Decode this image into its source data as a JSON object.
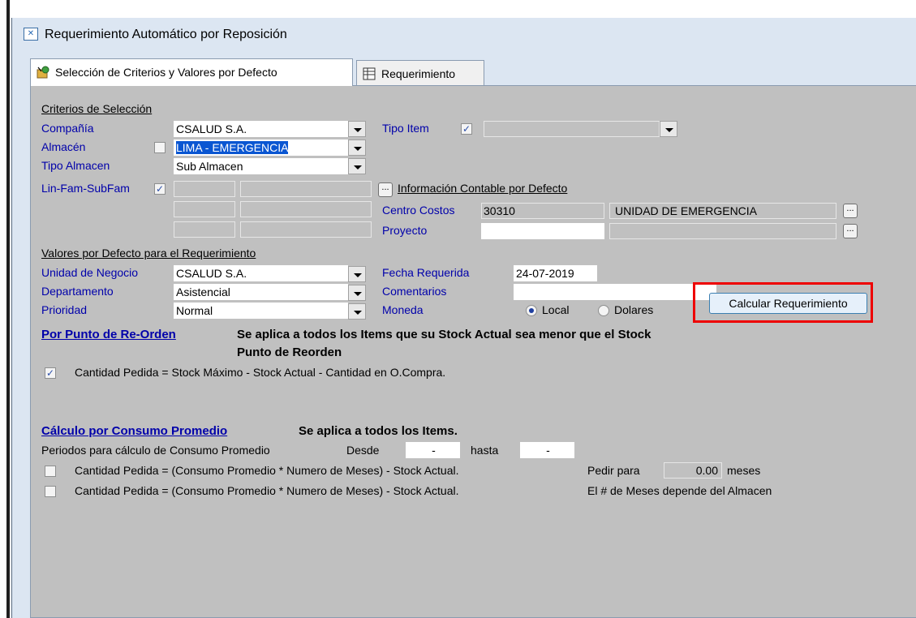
{
  "window": {
    "title": "Requerimiento Automático por Reposición"
  },
  "tabs": [
    {
      "label": "Selección de Criterios y Valores por Defecto",
      "icon": "criteria-icon"
    },
    {
      "label": "Requerimiento",
      "icon": "grid-icon"
    }
  ],
  "criterios": {
    "heading": "Criterios de Selección",
    "compania_label": "Compañía",
    "compania_value": "CSALUD S.A.",
    "tipo_item_label": "Tipo Item",
    "tipo_item_value": "",
    "almacen_label": "Almacén",
    "almacen_value": "LIMA - EMERGENCIA",
    "tipo_almacen_label": "Tipo Almacen",
    "tipo_almacen_value": "Sub Almacen",
    "linfam_label": "Lin-Fam-SubFam"
  },
  "contable": {
    "heading": "Información Contable por Defecto",
    "centro_label": "Centro Costos",
    "centro_code": "30310",
    "centro_name": "UNIDAD DE EMERGENCIA",
    "proyecto_label": "Proyecto",
    "proyecto_code": "",
    "proyecto_name": ""
  },
  "valores": {
    "heading": "Valores por Defecto para el Requerimiento",
    "unidad_label": "Unidad de Negocio",
    "unidad_value": "CSALUD S.A.",
    "fecha_label": "Fecha Requerida",
    "fecha_value": "24-07-2019",
    "depto_label": "Departamento",
    "depto_value": "Asistencial",
    "comentarios_label": "Comentarios",
    "comentarios_value": "",
    "prioridad_label": "Prioridad",
    "prioridad_value": "Normal",
    "moneda_label": "Moneda",
    "moneda_local": "Local",
    "moneda_dolares": "Dolares",
    "calcular_button": "Calcular Requerimiento"
  },
  "reorden": {
    "link": "Por Punto de Re-Orden",
    "desc_line1": "Se aplica a todos los Items que su Stock Actual sea menor que el Stock",
    "desc_line2": "Punto de Reorden",
    "formula": "Cantidad Pedida  =  Stock Máximo - Stock Actual - Cantidad en O.Compra."
  },
  "consumo": {
    "link": "Cálculo por Consumo Promedio",
    "desc": "Se aplica a todos los Items.",
    "periodos_label": "Periodos para cálculo de Consumo Promedio",
    "desde_label": "Desde",
    "desde_value": "-",
    "hasta_label": "hasta",
    "hasta_value": "-",
    "formula1": "Cantidad Pedida  =  (Consumo Promedio * Numero de Meses) - Stock Actual.",
    "pedir_label": "Pedir para",
    "pedir_value": "0.00",
    "meses_label": "meses",
    "formula2": "Cantidad Pedida  =  (Consumo Promedio * Numero de Meses) - Stock Actual.",
    "formula2_note": "El # de Meses depende del Almacen"
  },
  "colors": {
    "label_blue": "#0000aa",
    "panel_gray": "#c0c0c0",
    "highlight_red": "#ee0000"
  }
}
